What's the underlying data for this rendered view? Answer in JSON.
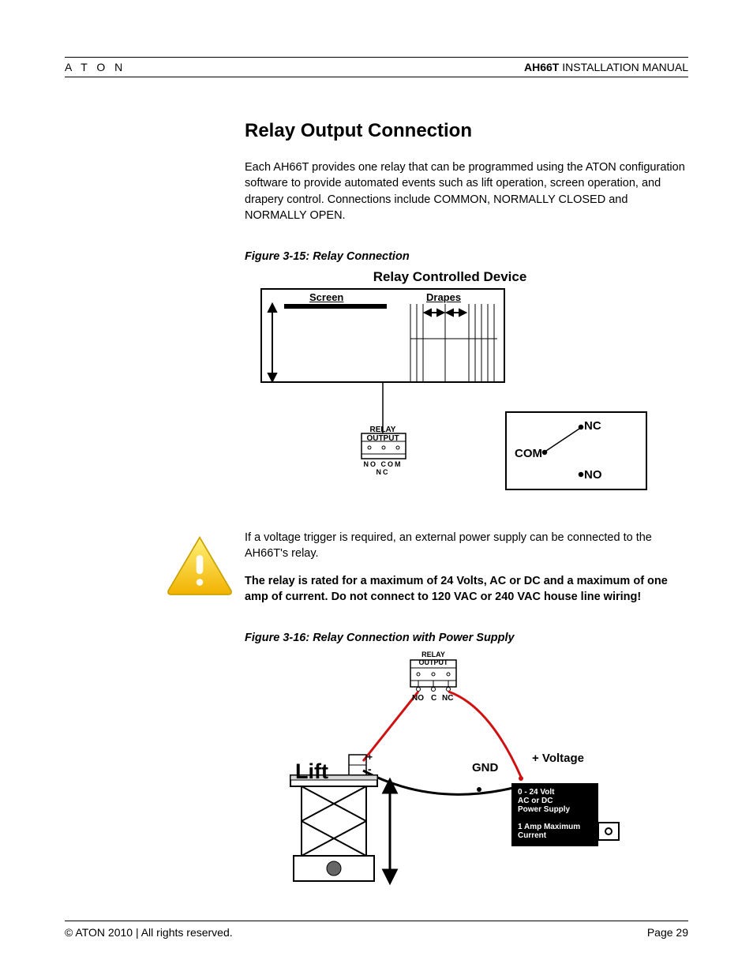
{
  "header": {
    "left": "A T O N",
    "right_bold": "AH66T",
    "right_rest": " INSTALLATION MANUAL"
  },
  "section": {
    "title": "Relay Output Connection",
    "para1": "Each AH66T provides one relay that can be programmed using the ATON configuration software to provide automated events such as lift operation, screen operation, and drapery control.  Connections include COMMON, NORMALLY CLOSED and NORMALLY OPEN."
  },
  "fig15": {
    "caption": "Figure 3-15: Relay Connection",
    "title": "Relay Controlled Device",
    "screen": "Screen",
    "drapes": "Drapes",
    "relay_output": "RELAY OUTPUT",
    "terminals": "NO  COM  NC",
    "com": "COM",
    "nc": "NC",
    "no": "NO"
  },
  "warning": {
    "para": "If a voltage trigger is required, an external power supply can be connected to the AH66T's relay.",
    "bold": "The relay is rated for a maximum of 24 Volts, AC or DC and a maximum of one amp of current.  Do not connect to 120 VAC or 240 VAC house line wiring!"
  },
  "fig16": {
    "caption": "Figure 3-16: Relay Connection with Power Supply",
    "relay_output": "RELAY OUTPUT",
    "no": "NO",
    "c": "C",
    "nc": "NC",
    "lift": "Lift",
    "gnd": "GND",
    "voltage": "+ Voltage",
    "ps1": "0 - 24 Volt",
    "ps2": "AC or DC",
    "ps3": "Power Supply",
    "ps4": "1 Amp Maximum",
    "ps5": "Current",
    "plus": "+",
    "minus": "-"
  },
  "footer": {
    "left": "© ATON 2010 | All rights reserved.",
    "right": "Page 29"
  }
}
